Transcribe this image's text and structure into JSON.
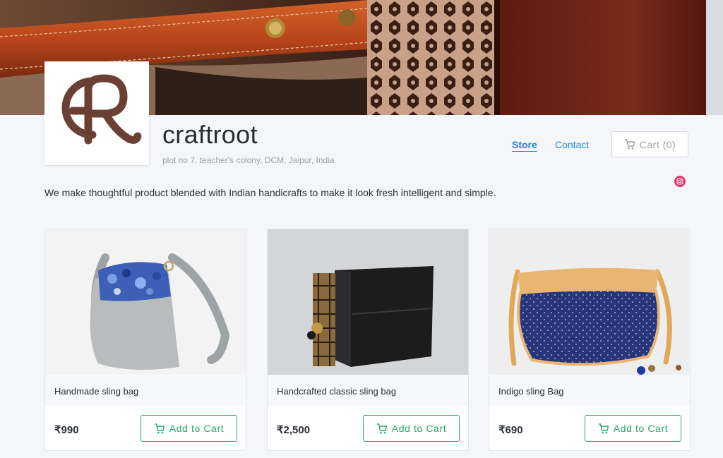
{
  "banner": {
    "image": "leather-bag-banner"
  },
  "store": {
    "name": "craftroot",
    "address": "plot no 7, teacher's colony, DCM, Jaipur, India",
    "tagline": "We make thoughtful product blended with Indian handicrafts to make it look fresh intelligent and simple.",
    "logo_icon": "craftroot-logo",
    "logo_color": "#6b4034"
  },
  "nav": {
    "store_label": "Store",
    "contact_label": "Contact",
    "cart_label": "Cart (0)",
    "link_color": "#1a8bd8",
    "instagram_icon": "instagram-icon"
  },
  "products": [
    {
      "title": "Handmade sling bag",
      "price": "₹990",
      "add_label": "Add to Cart",
      "image": "grey-embroidered-sling-bag"
    },
    {
      "title": "Handcrafted classic sling bag",
      "price": "₹2,500",
      "add_label": "Add to Cart",
      "image": "black-box-sling-bag"
    },
    {
      "title": "Indigo sling Bag",
      "price": "₹690",
      "add_label": "Add to Cart",
      "image": "indigo-sling-bag"
    }
  ],
  "colors": {
    "accent_green": "#26a96c",
    "instagram": "#e1306c"
  }
}
